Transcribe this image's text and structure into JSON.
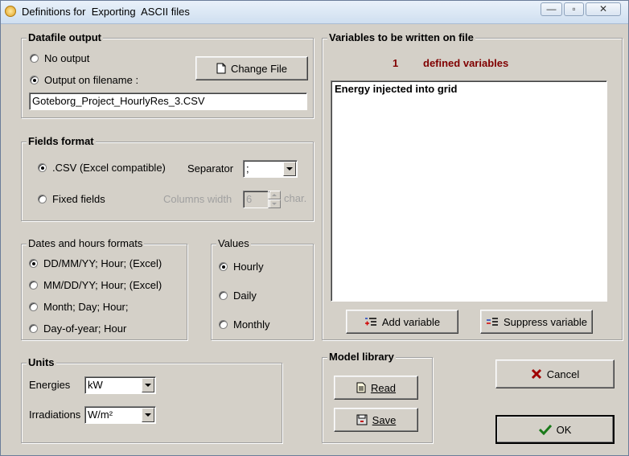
{
  "window": {
    "title": "Definitions for  Exporting  ASCII files",
    "minimize": "—",
    "maximize": "▫",
    "close": "✕"
  },
  "datafile": {
    "legend": "Datafile output",
    "no_output": "No output",
    "output_on_filename": "Output on filename :",
    "selected": "output_on_filename",
    "change_file": "Change File",
    "filename": "Goteborg_Project_HourlyRes_3.CSV"
  },
  "fields": {
    "legend": "Fields format",
    "csv": ".CSV  (Excel compatible)",
    "fixed": "Fixed fields",
    "selected": "csv",
    "separator_label": "Separator",
    "separator_value": ";",
    "columns_width_label": "Columns width",
    "columns_width_value": "6",
    "char_label": "char."
  },
  "dates": {
    "legend": "Dates and hours formats",
    "options": [
      "DD/MM/YY; Hour;  (Excel)",
      "MM/DD/YY; Hour;  (Excel)",
      "Month; Day; Hour;",
      "Day-of-year; Hour"
    ],
    "selected": 0
  },
  "values": {
    "legend": "Values",
    "options": [
      "Hourly",
      "Daily",
      "Monthly"
    ],
    "selected": 0
  },
  "variables": {
    "legend": "Variables to be written on file",
    "count": "1",
    "count_label": "defined variables",
    "list": [
      "Energy injected into grid"
    ],
    "add_button": "Add variable",
    "suppress_button": "Suppress variable"
  },
  "units": {
    "legend": "Units",
    "energies_label": "Energies",
    "energies_value": "kW",
    "irradiations_label": "Irradiations",
    "irradiations_value": "W/m²"
  },
  "model_library": {
    "legend": "Model library",
    "read": "Read",
    "save": "Save"
  },
  "actions": {
    "cancel": "Cancel",
    "ok": "OK"
  },
  "colors": {
    "count_color": "#800000",
    "cancel_icon": "#a00000",
    "ok_icon": "#1a7a1a"
  }
}
